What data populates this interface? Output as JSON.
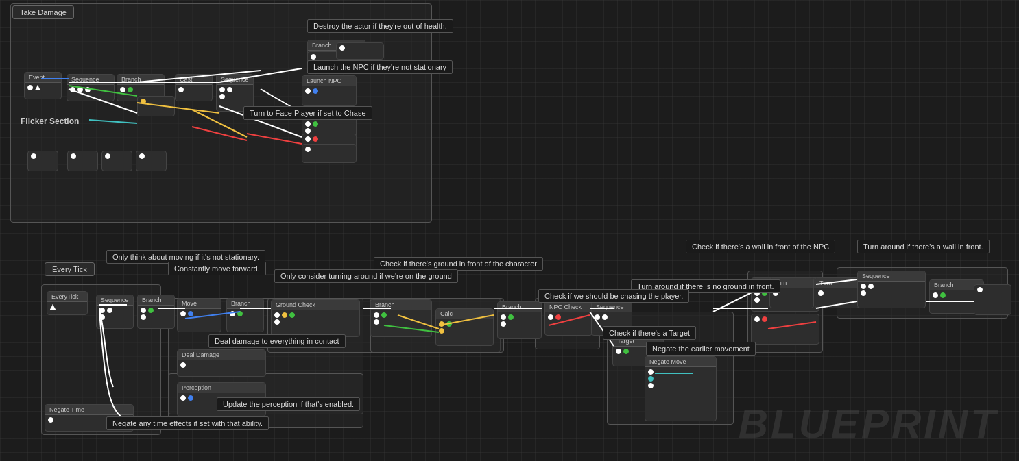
{
  "canvas": {
    "background": "#1c1c1c"
  },
  "labels": {
    "take_damage": "Take Damage",
    "flicker_section": "Flicker Section",
    "every_tick": "Every Tick",
    "destroy_actor": "Destroy the actor if they're out of health.",
    "launch_npc": "Launch the NPC if they're not stationary",
    "turn_face_player": "Turn to Face Player if set to Chase",
    "only_think_moving": "Only think about moving if it's not stationary.",
    "constantly_move": "Constantly move forward.",
    "check_ground_front": "Check if there's ground in front of the character",
    "only_consider": "Only consider turning around if we're on the ground",
    "deal_damage": "Deal damage to everything in contact",
    "update_perception": "Update the perception if that's enabled.",
    "negate_time": "Negate any time effects if set with that ability.",
    "check_wall": "Check if there's a wall in front of the NPC",
    "turn_around_wall": "Turn around if there's a wall in front.",
    "turn_around_ground": "Turn around if there is no ground in front.",
    "check_chasing": "Check if we should be chasing the player.",
    "check_target": "Check if there's a Target",
    "negate_movement": "Negate the earlier movement",
    "watermark": "BLUEPRINT"
  }
}
